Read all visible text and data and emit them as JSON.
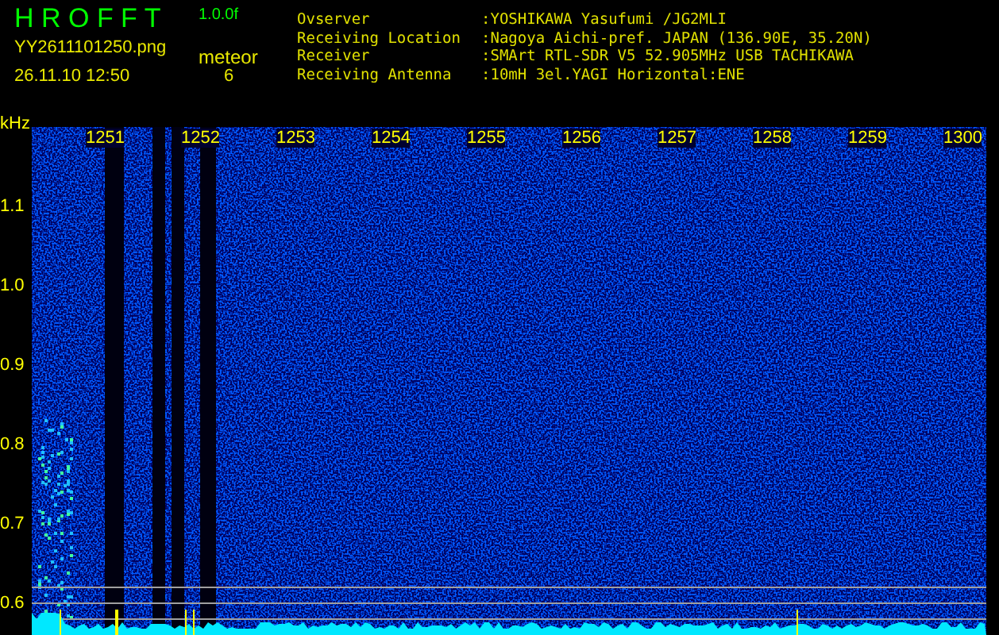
{
  "app": {
    "title": "H R O F F T",
    "version": "1.0.0f",
    "filename": "YY2611101250.png",
    "timestamp": "26.11.10 12:50",
    "counter_label": "meteor",
    "counter_value": "6"
  },
  "info": [
    {
      "label": "Ovserver",
      "value": ":YOSHIKAWA Yasufumi /JG2MLI"
    },
    {
      "label": "Receiving Location",
      "value": ":Nagoya Aichi-pref. JAPAN (136.90E, 35.20N)"
    },
    {
      "label": "Receiver",
      "value": ":SMArt RTL-SDR V5 52.905MHz USB TACHIKAWA"
    },
    {
      "label": "Receiving Antenna",
      "value": ":10mH 3el.YAGI Horizontal:ENE"
    }
  ],
  "spectrogram": {
    "unit": "kHz",
    "time_labels": [
      "1251",
      "1252",
      "1253",
      "1254",
      "1255",
      "1256",
      "1257",
      "1258",
      "1259",
      "1300"
    ],
    "freq_labels": [
      "1.1",
      "1.0",
      "0.9",
      "0.8",
      "0.7",
      "0.6"
    ]
  }
}
